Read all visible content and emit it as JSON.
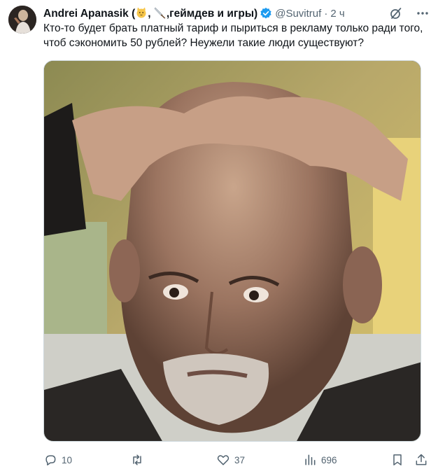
{
  "tweet": {
    "author_name": "Andrei Apanasik",
    "author_tags_open": "(",
    "author_tags_sep": ",",
    "author_tags_text": ",геймдев и игры)",
    "handle": "@Suvitruf",
    "separator": "·",
    "time": "2 ч",
    "text": "Кто-то будет брать платный тариф и пыриться в рекламу только ради того, чтоб сэкономить 50 рублей? Неужели такие люди существуют?",
    "image_alt": "",
    "stats": {
      "replies": "10",
      "likes": "37",
      "views": "696"
    }
  },
  "icons": {
    "header": [
      "cat-emoji-icon",
      "knife-emoji-icon",
      "verified-badge-icon",
      "grok-icon",
      "more-icon"
    ],
    "actions": [
      "reply-icon",
      "retweet-icon",
      "like-icon",
      "views-icon",
      "bookmark-icon",
      "share-icon"
    ]
  },
  "colors": {
    "text": "#0f1419",
    "secondary": "#536471",
    "verified": "#1d9bf0",
    "border": "#cfd9de"
  }
}
